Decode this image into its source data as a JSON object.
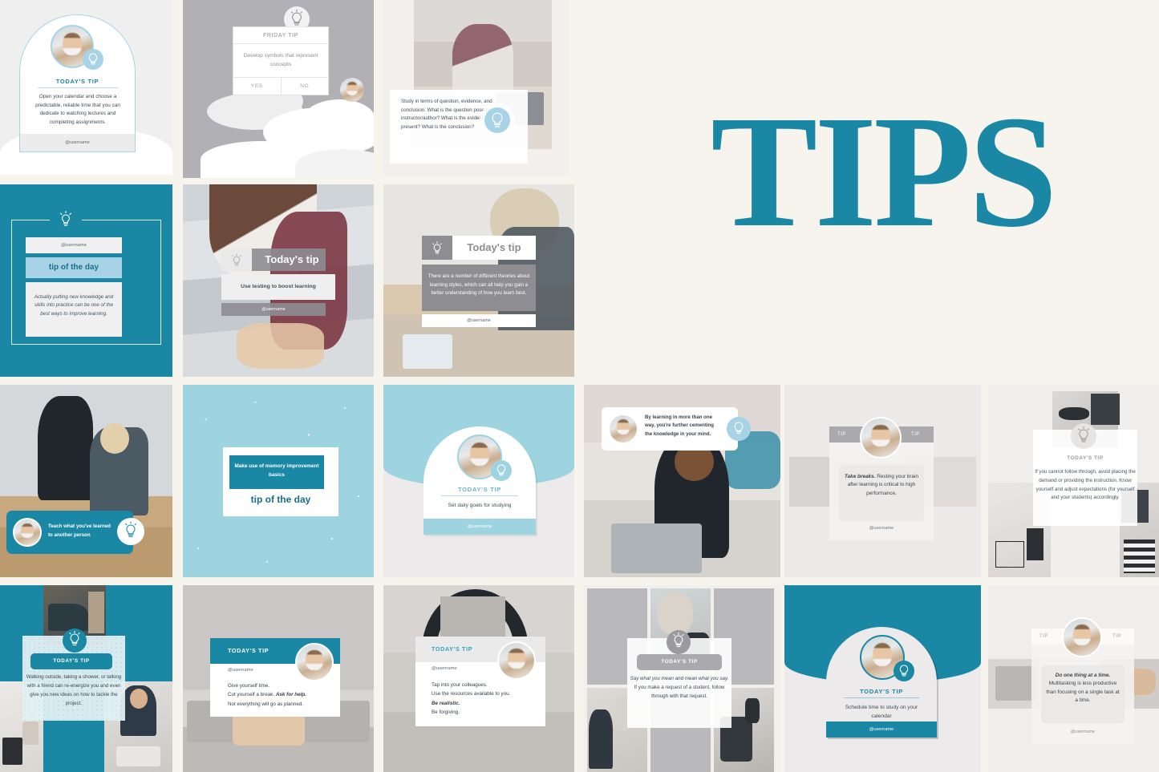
{
  "page": {
    "background_color": "#f7f3ed",
    "accent_teal": "#1a87a4",
    "accent_lightblue": "#9ed3e0",
    "accent_grey": "#8d8d92",
    "title": "TIPS",
    "username": "@username"
  },
  "tiles": [
    {
      "id": "tile-arch-todays-tip",
      "style": "arch-card-white",
      "heading": "TODAY'S TIP",
      "body": "Open your calendar and choose a predictable, reliable time that you can dedicate to watching lectures and completing assignments.",
      "footer": "@username",
      "icon": "lightbulb-icon",
      "avatar": "avatar-woman"
    },
    {
      "id": "tile-friday-tip-poll",
      "style": "grey-clouds",
      "heading": "FRIDAY TIP",
      "body": "Develop symbols that represent concepts",
      "options": [
        "YES",
        "NO"
      ],
      "icon": "lightbulb-icon",
      "avatar": "avatar-woman"
    },
    {
      "id": "tile-study-question",
      "style": "photo-overlay-bubble",
      "body": "Study in terms of question, evidence, and conclusion: What is the question posed by the instructor/author? What is the evidence that they present? What is the conclusion?",
      "icon": "lightbulb-icon"
    },
    {
      "id": "tile-title-tips",
      "style": "plain-title",
      "heading": "TIPS"
    },
    {
      "id": "tile-teal-tip-of-day",
      "style": "teal-frame",
      "username": "@username",
      "heading": "tip of the day",
      "body": "Actually putting new knowledge and skills into practice can be one of the best ways to improve learning.",
      "icon": "lightbulb-icon"
    },
    {
      "id": "tile-use-testing",
      "style": "photo-banner-grey",
      "heading": "Today's tip",
      "body": "Use testing to boost learning",
      "footer": "@username",
      "icon": "lightbulb-icon"
    },
    {
      "id": "tile-learning-styles",
      "style": "photo-banner-grey",
      "heading": "Today's tip",
      "body": "There are a number of different theories about learning styles, which can all help you gain a better understanding of how you learn best.",
      "footer": "@username",
      "icon": "lightbulb-icon"
    },
    {
      "id": "tile-teach-another",
      "style": "photo-pill-teal",
      "body": "Teach what you've learned to another person",
      "icon": "lightbulb-icon",
      "avatar": "avatar-woman"
    },
    {
      "id": "tile-memory-basics",
      "style": "sparkle-blue",
      "heading": "Make use of memory improvement basics",
      "subheading": "tip of the day"
    },
    {
      "id": "tile-daily-goals",
      "style": "arch-card-blue",
      "heading": "TODAY'S TIP",
      "body": "Set daily goals for studying",
      "footer": "@username",
      "icon": "lightbulb-icon",
      "avatar": "avatar-woman"
    },
    {
      "id": "tile-learning-more-ways",
      "style": "photo-speech-bubble",
      "body": "By learning in more than one way, you're further cementing the knowledge in your mind.",
      "icon": "lightbulb-icon",
      "avatar": "avatar-woman"
    },
    {
      "id": "tile-take-breaks",
      "style": "tip-tip-card",
      "tag_left": "TIP",
      "tag_right": "TIP",
      "body_bold": "Take breaks.",
      "body": "Resting your brain after learning is critical to high performance.",
      "footer": "@username",
      "avatar": "avatar-woman"
    },
    {
      "id": "tile-follow-through",
      "style": "collage-overlay",
      "heading": "TODAY'S TIP",
      "body": "If you cannot follow through, avoid placing the demand or providing the instruction. Know yourself and adjust expectations (for yourself and your students) accordingly.",
      "icon": "lightbulb-icon"
    },
    {
      "id": "tile-re-energize",
      "style": "collage-teal",
      "heading": "TODAY'S TIP",
      "body": "Walking outside, taking a shower, or talking with a friend can re-energize you and even give you new ideas on how to tackle the project.",
      "icon": "lightbulb-icon"
    },
    {
      "id": "tile-give-yourself-time",
      "style": "card-teal-header",
      "heading": "TODAY'S TIP",
      "username": "@username",
      "lines": [
        "Give yourself time.",
        "Cut yourself a break. ",
        "Ask for help.",
        "Not everything will go as planned."
      ],
      "avatar": "avatar-woman"
    },
    {
      "id": "tile-tap-colleagues",
      "style": "card-grey-header",
      "heading": "TODAY'S TIP",
      "username": "@username",
      "lines": [
        "Tap into your colleagues.",
        "Use the resources available to you.",
        "Be realistic.",
        "Be forgiving."
      ],
      "avatar": "avatar-woman"
    },
    {
      "id": "tile-say-what-you-mean",
      "style": "collage-grey",
      "heading": "TODAY'S TIP",
      "body_italic": "Say what you mean and mean what you say.",
      "body": "If you make a request of a student, follow through with that request.",
      "icon": "lightbulb-icon"
    },
    {
      "id": "tile-schedule-time",
      "style": "arch-card-teal",
      "heading": "TODAY'S TIP",
      "body": "Schedule time to study on your calendar",
      "footer": "@username",
      "icon": "lightbulb-icon",
      "avatar": "avatar-woman"
    },
    {
      "id": "tile-one-thing-at-a-time",
      "style": "tip-tip-card",
      "tag_left": "TIP",
      "tag_right": "TIP",
      "body_bold": "Do one thing at a time.",
      "body": "Multitasking is less productive than focusing on a single task at a time.",
      "footer": "@username",
      "avatar": "avatar-woman"
    }
  ]
}
